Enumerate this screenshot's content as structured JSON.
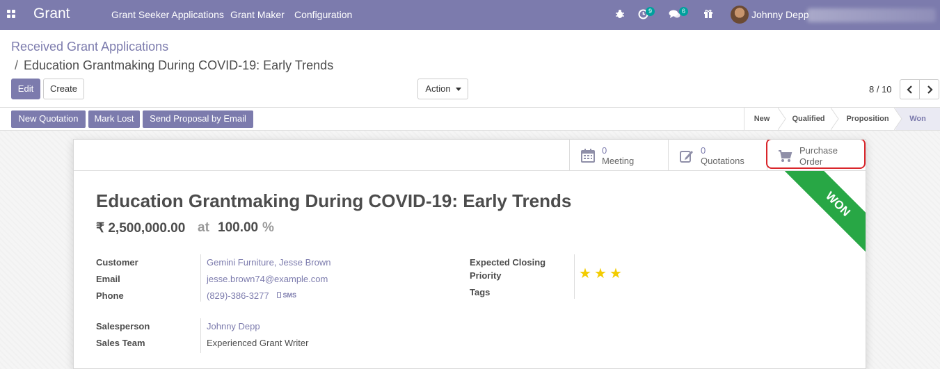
{
  "navbar": {
    "brand": "Grant",
    "menu": [
      "Grant Seeker Applications",
      "Grant Maker",
      "Configuration"
    ],
    "activity_count": "9",
    "messages_count": "6",
    "user_name": "Johnny Depp"
  },
  "breadcrumb": {
    "parent": "Received Grant Applications",
    "separator": "/",
    "current": "Education Grantmaking During COVID-19: Early Trends"
  },
  "control_panel": {
    "edit_label": "Edit",
    "create_label": "Create",
    "action_label": "Action",
    "pager": "8 / 10"
  },
  "statusbar": {
    "buttons": [
      "New Quotation",
      "Mark Lost",
      "Send Proposal by Email"
    ],
    "stages": [
      "New",
      "Qualified",
      "Proposition",
      "Won"
    ],
    "active_stage": "Won"
  },
  "smart_buttons": {
    "meeting": {
      "count": "0",
      "label": "Meeting"
    },
    "quotations": {
      "count": "0",
      "label": "Quotations"
    },
    "purchase_order": {
      "label_line1": "Purchase",
      "label_line2": "Order"
    }
  },
  "ribbon": "WON",
  "record": {
    "title": "Education Grantmaking During COVID-19: Early Trends",
    "expected_revenue": "₹ 2,500,000.00",
    "at": "at",
    "probability": "100.00",
    "probability_unit": "%",
    "customer_label": "Customer",
    "customer": "Gemini Furniture, Jesse Brown",
    "email_label": "Email",
    "email": "jesse.brown74@example.com",
    "phone_label": "Phone",
    "phone": "(829)-386-3277",
    "sms_label": "SMS",
    "expected_closing_label": "Expected Closing",
    "priority_label": "Priority",
    "priority": 3,
    "tags_label": "Tags",
    "salesperson_label": "Salesperson",
    "salesperson": "Johnny Depp",
    "sales_team_label": "Sales Team",
    "sales_team": "Experienced Grant Writer"
  },
  "colors": {
    "navbar": "#7c7bad",
    "primary": "#7c7bad",
    "ribbon": "#28a745",
    "star": "#f3cc00",
    "highlight": "#d9262b"
  }
}
